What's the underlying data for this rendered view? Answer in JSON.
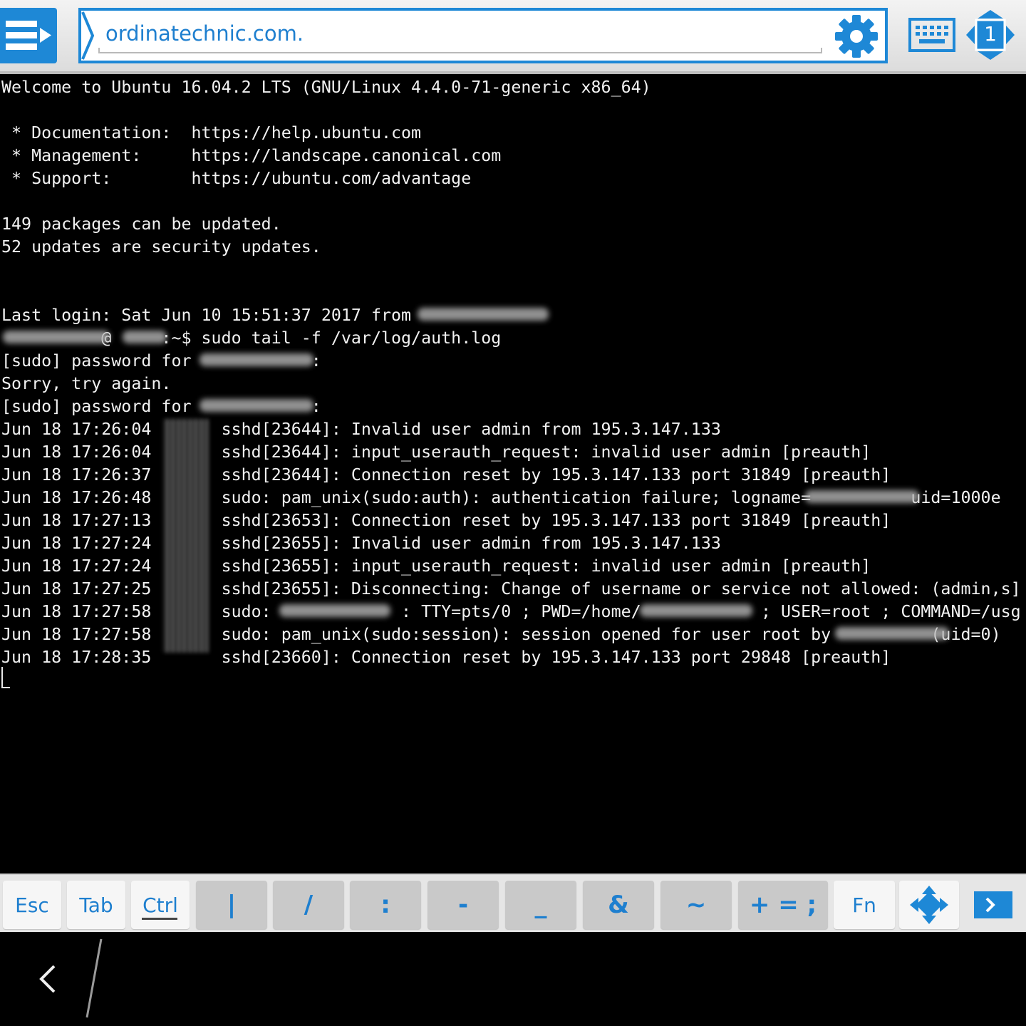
{
  "address_bar": {
    "value": "ordinatechnic.com."
  },
  "session": {
    "number": "1"
  },
  "terminal": {
    "lines": [
      "Welcome to Ubuntu 16.04.2 LTS (GNU/Linux 4.4.0-71-generic x86_64)",
      "",
      " * Documentation:  https://help.ubuntu.com",
      " * Management:     https://landscape.canonical.com",
      " * Support:        https://ubuntu.com/advantage",
      "",
      "149 packages can be updated.",
      "52 updates are security updates.",
      "",
      "",
      "Last login: Sat Jun 10 15:51:37 2017 from",
      "          @     :~$ sudo tail -f /var/log/auth.log",
      "[sudo] password for            :",
      "Sorry, try again.",
      "[sudo] password for            :",
      "Jun 18 17:26:04       sshd[23644]: Invalid user admin from 195.3.147.133",
      "Jun 18 17:26:04       sshd[23644]: input_userauth_request: invalid user admin [preauth]",
      "Jun 18 17:26:37       sshd[23644]: Connection reset by 195.3.147.133 port 31849 [preauth]",
      "Jun 18 17:26:48       sudo: pam_unix(sudo:auth): authentication failure; logname=          uid=1000e",
      "Jun 18 17:27:13       sshd[23653]: Connection reset by 195.3.147.133 port 31849 [preauth]",
      "Jun 18 17:27:24       sshd[23655]: Invalid user admin from 195.3.147.133",
      "Jun 18 17:27:24       sshd[23655]: input_userauth_request: invalid user admin [preauth]",
      "Jun 18 17:27:25       sshd[23655]: Disconnecting: Change of username or service not allowed: (admin,s]",
      "Jun 18 17:27:58       sudo:             : TTY=pts/0 ; PWD=/home/            ; USER=root ; COMMAND=/usg",
      "Jun 18 17:27:58       sudo: pam_unix(sudo:session): session opened for user root by          (uid=0)",
      "Jun 18 17:28:35       sshd[23660]: Connection reset by 195.3.147.133 port 29848 [preauth]"
    ]
  },
  "keys": {
    "esc": "Esc",
    "tab": "Tab",
    "ctrl": "Ctrl",
    "pipe": "|",
    "slash": "/",
    "colon": ":",
    "minus": "-",
    "underscore": "_",
    "ampersand": "&",
    "tilde": "~",
    "plus_equals_semicolon": "+ = ;",
    "fn": "Fn"
  },
  "colors": {
    "accent": "#1e88d6",
    "terminal_bg": "#000000",
    "terminal_fg": "#f2f2f2",
    "keybar_bg": "#e6e6e6"
  },
  "icons": {
    "menu": "menu-arrow-icon",
    "settings": "gear-icon",
    "keyboard": "keyboard-icon",
    "session": "session-switch-icon",
    "cursor_keys": "dpad-icon",
    "more_keys": "arrow-right-icon",
    "back": "back-chevron-icon"
  }
}
